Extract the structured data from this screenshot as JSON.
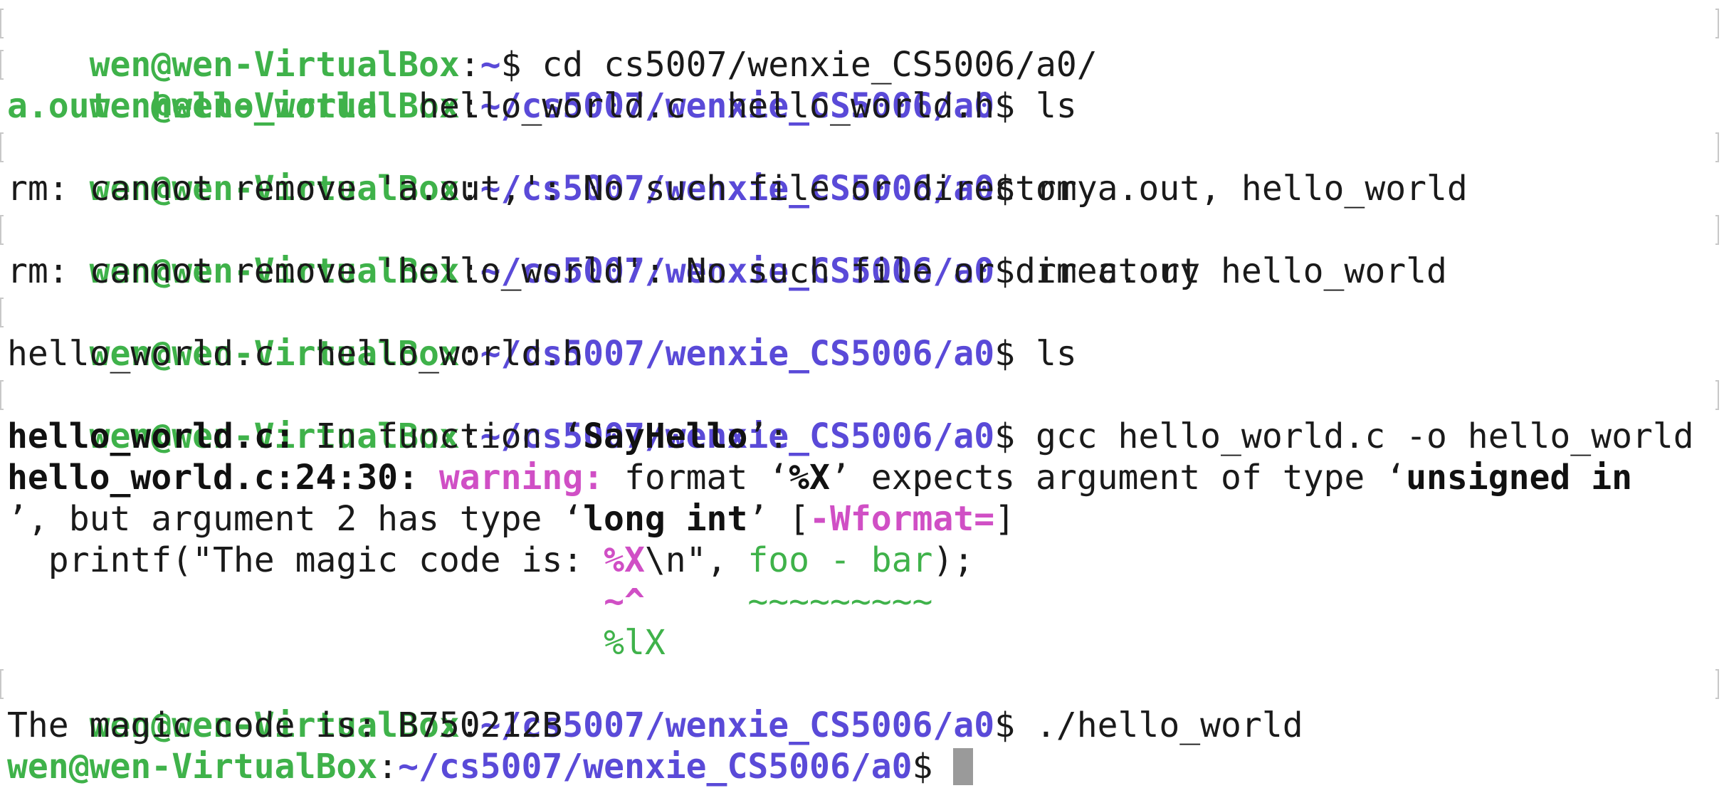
{
  "terminal": {
    "user_host": "wen@wen-VirtualBox",
    "colon": ":",
    "dollar": "$ ",
    "home_path": "~",
    "work_path": "~/cs5007/wenxie_CS5006/a0",
    "lines": {
      "cmd1": "cd cs5007/wenxie_CS5006/a0/",
      "cmd2": "ls",
      "ls1_exec1": "a.out",
      "ls1_gap1": "  ",
      "ls1_exec2": "hello_world",
      "ls1_rest": "  hello_world.c  hello_world.h",
      "cmd3": "rm a.out, hello_world",
      "err1": "rm: cannot remove 'a.out,': No such file or directory",
      "cmd4": "rm a.out hello_world",
      "err2": "rm: cannot remove 'hello_world': No such file or directory",
      "cmd5": "ls",
      "ls2": "hello_world.c  hello_world.h",
      "cmd6": "gcc hello_world.c -o hello_world",
      "diag1_file": "hello_world.c:",
      "diag1_text1": " In function ‘",
      "diag1_func": "SayHello",
      "diag1_text2": "’:",
      "diag2_loc": "hello_world.c:24:30:",
      "diag2_space": " ",
      "diag2_warning": "warning:",
      "diag2_text1": " format ‘",
      "diag2_fmt": "%X",
      "diag2_text2": "’ expects argument of type ‘",
      "diag2_type": "unsigned in",
      "diag3_text1": "’, but argument 2 has type ‘",
      "diag3_type": "long int",
      "diag3_text2": "’ [",
      "diag3_flag": "-Wformat=",
      "diag3_text3": "]",
      "src_pre": "  printf(\"The magic code is: ",
      "src_fmt": "%X",
      "src_mid": "\\n\", ",
      "src_expr": "foo - bar",
      "src_end": ");",
      "caret_pad": "                             ",
      "caret": "~^",
      "tilde_pad": "     ",
      "tildes": "~~~~~~~~~",
      "fix_pad": "                             ",
      "fix": "%lX",
      "cmd7": "./hello_world",
      "output": "The magic code is: B750212B"
    },
    "colors": {
      "prompt_user": "#3fb24a",
      "prompt_path": "#5a4ad8",
      "warning": "#d04fc5",
      "cursor": "#9a9a9a"
    }
  }
}
